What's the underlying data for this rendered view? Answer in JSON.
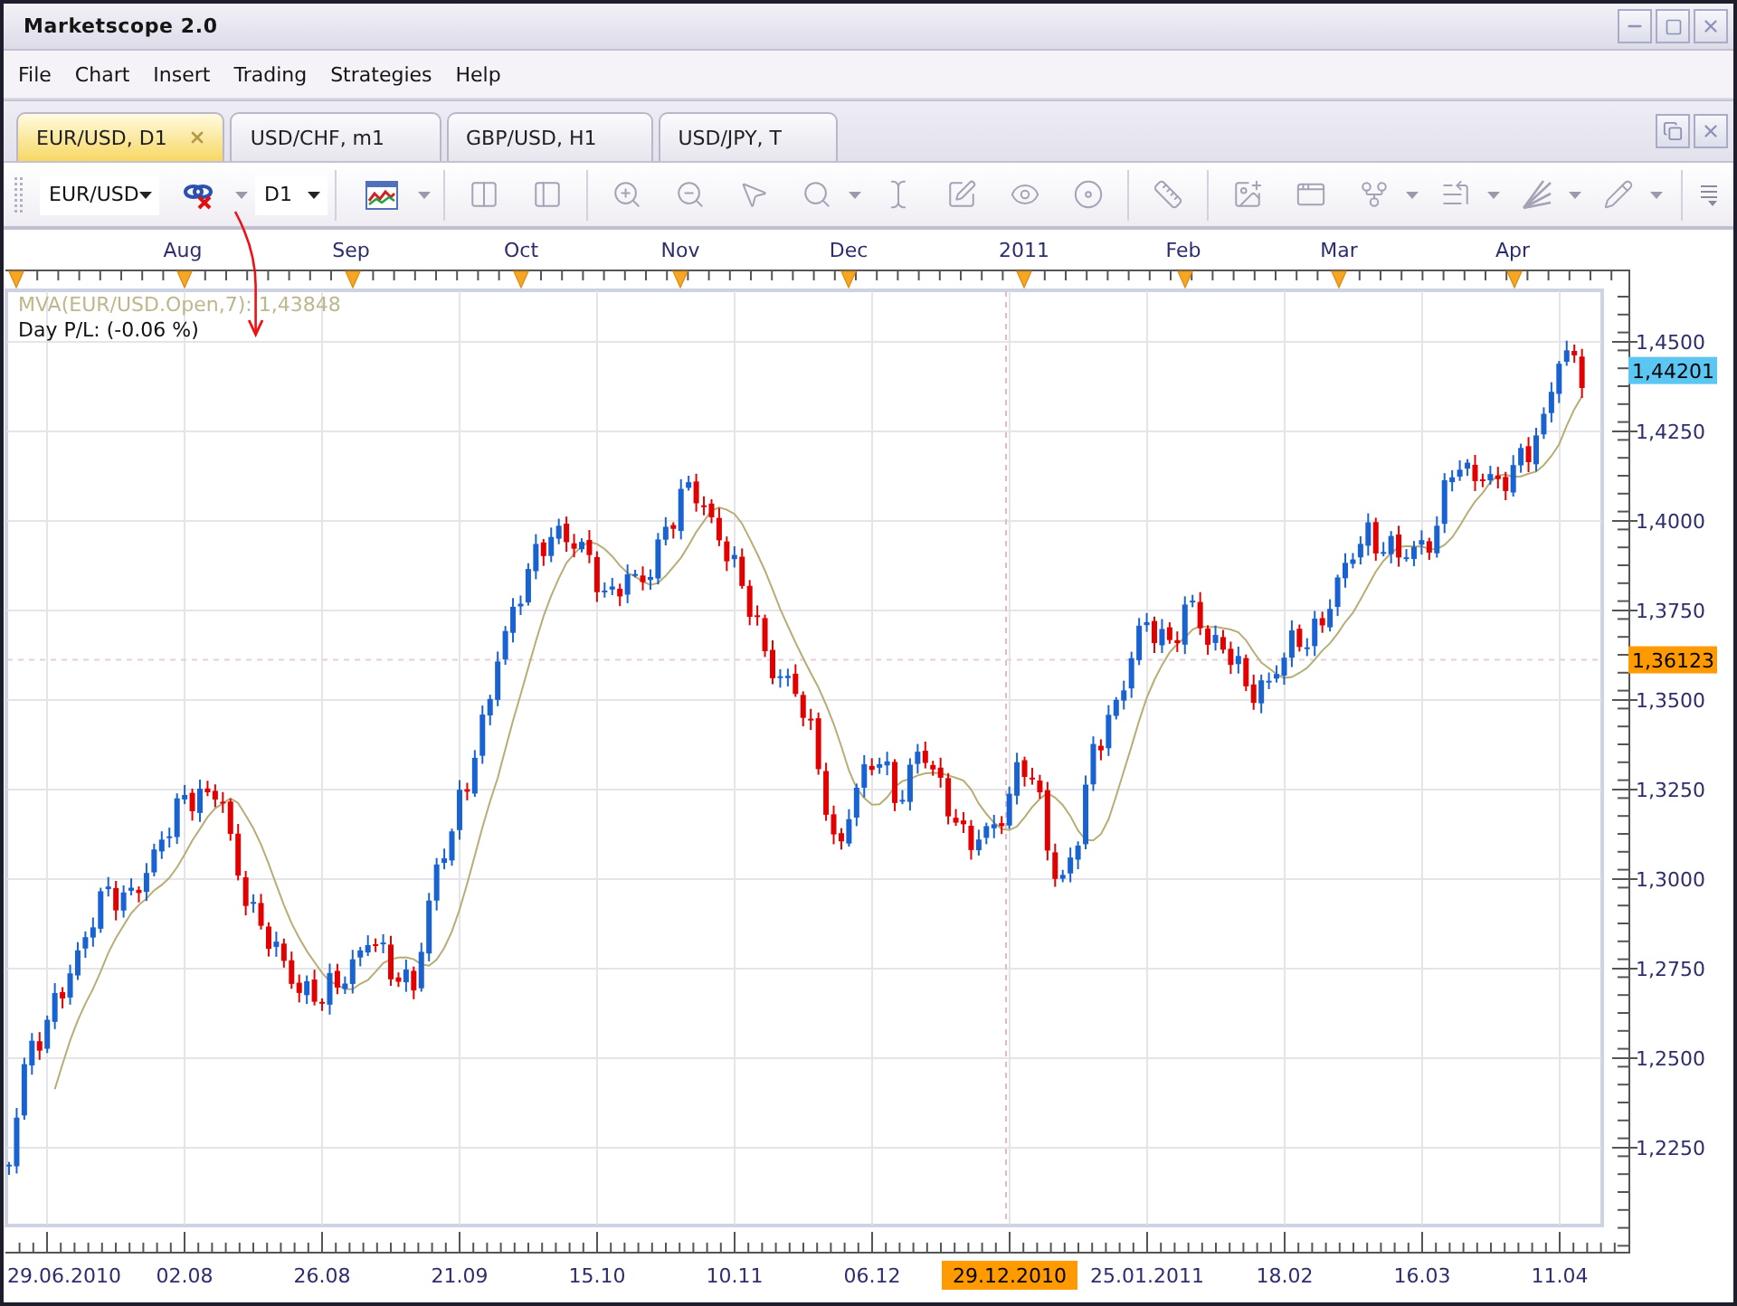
{
  "window": {
    "title": "Marketscope 2.0"
  },
  "menu": [
    "File",
    "Chart",
    "Insert",
    "Trading",
    "Strategies",
    "Help"
  ],
  "tabs": [
    {
      "label": "EUR/USD, D1",
      "selected": true
    },
    {
      "label": "USD/CHF, m1",
      "selected": false
    },
    {
      "label": "GBP/USD, H1",
      "selected": false
    },
    {
      "label": "USD/JPY, T",
      "selected": false
    }
  ],
  "toolbar": {
    "instrument": "EUR/USD",
    "timeframe": "D1"
  },
  "chart": {
    "legend": [
      {
        "kind": "indicator",
        "text": "MVA(EUR/USD.Open,7): 1,43848"
      },
      {
        "kind": "profit",
        "text": "Day P/L: (-0.06 %)"
      }
    ],
    "months": [
      "Aug",
      "Sep",
      "Oct",
      "Nov",
      "Dec",
      "2011",
      "Feb",
      "Mar",
      "Apr"
    ],
    "price_ticks": [
      "1,4500",
      "1,4250",
      "1,4000",
      "1,3750",
      "1,3500",
      "1,3250",
      "1,3000",
      "1,2750",
      "1,2500",
      "1,2250"
    ],
    "price_markers": [
      {
        "kind": "last",
        "label": "1,44201"
      },
      {
        "kind": "cursor",
        "label": "1,36123"
      }
    ],
    "date_ticks": [
      {
        "label": "29.06.2010",
        "highlighted": false
      },
      {
        "label": "02.08",
        "highlighted": false
      },
      {
        "label": "26.08",
        "highlighted": false
      },
      {
        "label": "21.09",
        "highlighted": false
      },
      {
        "label": "15.10",
        "highlighted": false
      },
      {
        "label": "10.11",
        "highlighted": false
      },
      {
        "label": "06.12",
        "highlighted": false
      },
      {
        "label": "29.12.2010",
        "highlighted": true
      },
      {
        "label": "25.01.2011",
        "highlighted": false
      },
      {
        "label": "18.02",
        "highlighted": false
      },
      {
        "label": "16.03",
        "highlighted": false
      },
      {
        "label": "11.04",
        "highlighted": false
      }
    ]
  }
}
